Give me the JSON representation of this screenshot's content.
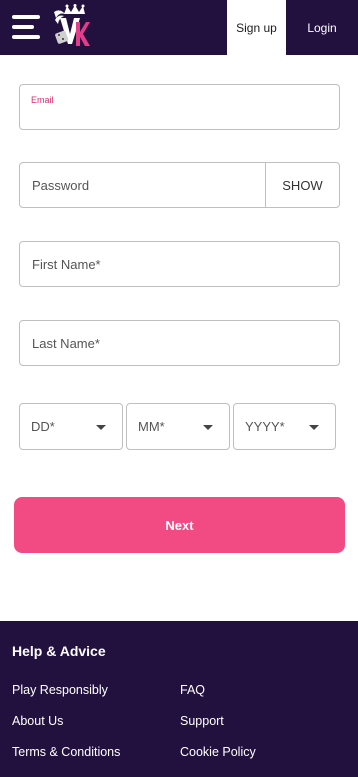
{
  "header": {
    "signup_label": "Sign up",
    "login_label": "Login"
  },
  "form": {
    "email_label": "Email",
    "password_placeholder": "Password",
    "show_label": "SHOW",
    "first_name_placeholder": "First Name*",
    "last_name_placeholder": "Last Name*",
    "dob": {
      "day": "DD*",
      "month": "MM*",
      "year": "YYYY*"
    },
    "next_label": "Next"
  },
  "footer": {
    "title": "Help & Advice",
    "links": [
      "Play Responsibly",
      "FAQ",
      "About Us",
      "Support",
      "Terms & Conditions",
      "Cookie Policy"
    ]
  },
  "colors": {
    "header_bg": "#22113f",
    "accent_pink": "#f24a82",
    "label_pink": "#d6326e"
  },
  "icons": {
    "menu": "hamburger-menu-icon",
    "logo": "crown-logo-icon",
    "caret": "caret-down-icon"
  }
}
